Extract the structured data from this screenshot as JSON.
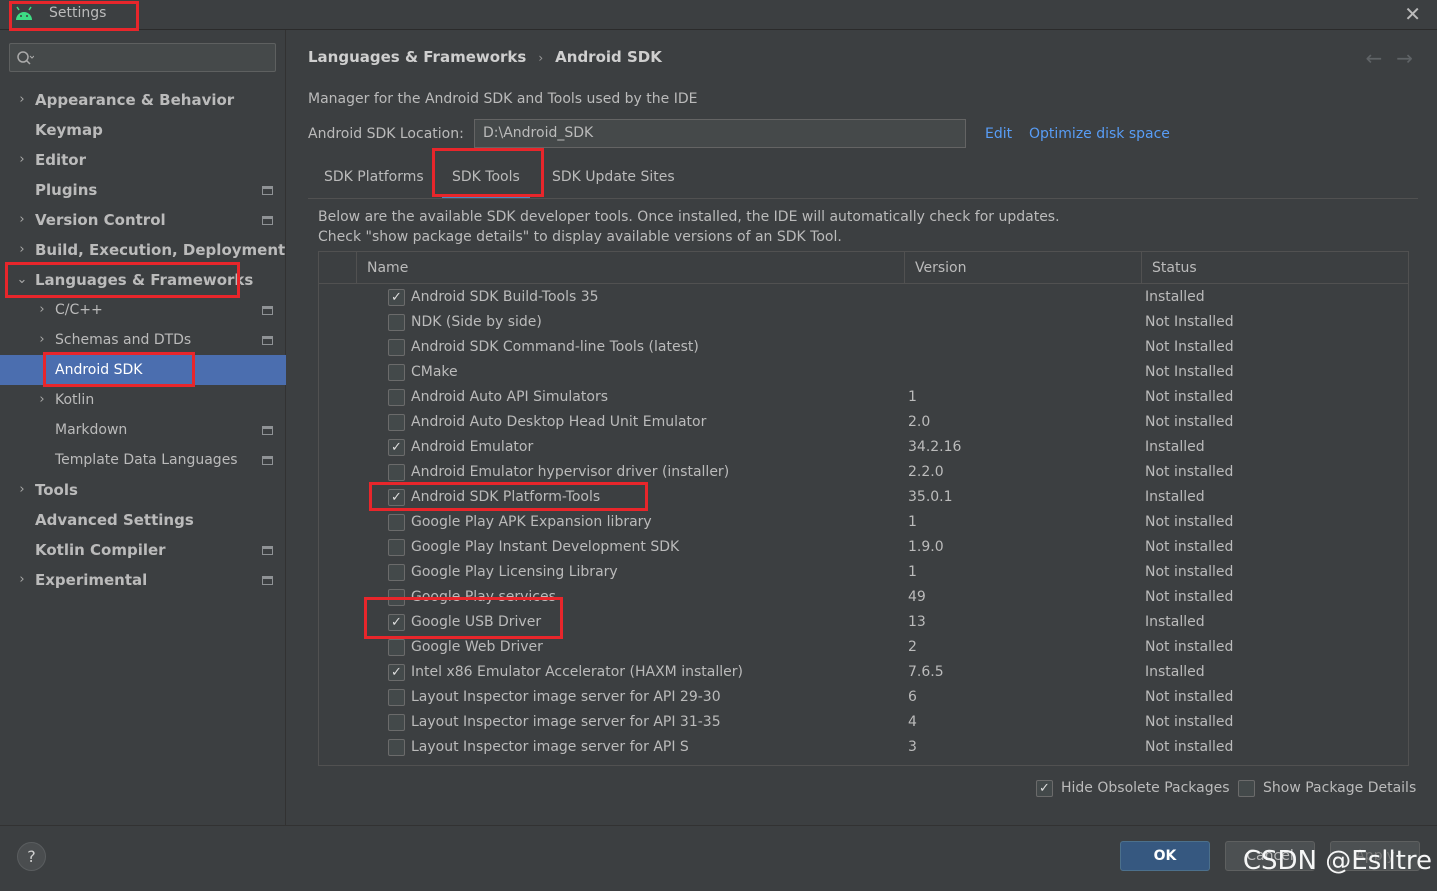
{
  "window": {
    "title": "Settings",
    "close": "✕"
  },
  "sidebar": {
    "items": [
      {
        "label": "Appearance & Behavior",
        "chevron": "›"
      },
      {
        "label": "Keymap"
      },
      {
        "label": "Editor",
        "chevron": "›"
      },
      {
        "label": "Plugins"
      },
      {
        "label": "Version Control",
        "chevron": "›"
      },
      {
        "label": "Build, Execution, Deployment",
        "chevron": "›"
      },
      {
        "label": "Languages & Frameworks",
        "chevron": "⌄"
      },
      {
        "label": "C/C++",
        "chevron": "›"
      },
      {
        "label": "Schemas and DTDs",
        "chevron": "›"
      },
      {
        "label": "Android SDK"
      },
      {
        "label": "Kotlin",
        "chevron": "›"
      },
      {
        "label": "Markdown"
      },
      {
        "label": "Template Data Languages"
      },
      {
        "label": "Tools",
        "chevron": "›"
      },
      {
        "label": "Advanced Settings"
      },
      {
        "label": "Kotlin Compiler"
      },
      {
        "label": "Experimental",
        "chevron": "›"
      }
    ]
  },
  "breadcrumb": {
    "parent": "Languages & Frameworks",
    "separator": "›",
    "current": "Android SDK"
  },
  "nav_arrows": "←→",
  "main": {
    "description": "Manager for the Android SDK and Tools used by the IDE",
    "location_label": "Android SDK Location:",
    "location_value": "D:\\Android_SDK",
    "edit_link": "Edit",
    "optimize_link": "Optimize disk space",
    "tabs": [
      "SDK Platforms",
      "SDK Tools",
      "SDK Update Sites"
    ],
    "active_tab": "SDK Tools",
    "tool_description": "Below are the available SDK developer tools. Once installed, the IDE will automatically check for updates. Check \"show package details\" to display available versions of an SDK Tool."
  },
  "table": {
    "headers": {
      "name": "Name",
      "version": "Version",
      "status": "Status"
    },
    "rows": [
      {
        "checked": true,
        "name": "Android SDK Build-Tools 35",
        "version": "",
        "status": "Installed"
      },
      {
        "checked": false,
        "name": "NDK (Side by side)",
        "version": "",
        "status": "Not Installed"
      },
      {
        "checked": false,
        "name": "Android SDK Command-line Tools (latest)",
        "version": "",
        "status": "Not Installed"
      },
      {
        "checked": false,
        "name": "CMake",
        "version": "",
        "status": "Not Installed"
      },
      {
        "checked": false,
        "name": "Android Auto API Simulators",
        "version": "1",
        "status": "Not installed"
      },
      {
        "checked": false,
        "name": "Android Auto Desktop Head Unit Emulator",
        "version": "2.0",
        "status": "Not installed"
      },
      {
        "checked": true,
        "name": "Android Emulator",
        "version": "34.2.16",
        "status": "Installed"
      },
      {
        "checked": false,
        "name": "Android Emulator hypervisor driver (installer)",
        "version": "2.2.0",
        "status": "Not installed"
      },
      {
        "checked": true,
        "name": "Android SDK Platform-Tools",
        "version": "35.0.1",
        "status": "Installed"
      },
      {
        "checked": false,
        "name": "Google Play APK Expansion library",
        "version": "1",
        "status": "Not installed"
      },
      {
        "checked": false,
        "name": "Google Play Instant Development SDK",
        "version": "1.9.0",
        "status": "Not installed"
      },
      {
        "checked": false,
        "name": "Google Play Licensing Library",
        "version": "1",
        "status": "Not installed"
      },
      {
        "checked": false,
        "name": "Google Play services",
        "version": "49",
        "status": "Not installed"
      },
      {
        "checked": true,
        "name": "Google USB Driver",
        "version": "13",
        "status": "Installed"
      },
      {
        "checked": false,
        "name": "Google Web Driver",
        "version": "2",
        "status": "Not installed"
      },
      {
        "checked": true,
        "name": "Intel x86 Emulator Accelerator (HAXM installer)",
        "version": "7.6.5",
        "status": "Installed"
      },
      {
        "checked": false,
        "name": "Layout Inspector image server for API 29-30",
        "version": "6",
        "status": "Not installed"
      },
      {
        "checked": false,
        "name": "Layout Inspector image server for API 31-35",
        "version": "4",
        "status": "Not installed"
      },
      {
        "checked": false,
        "name": "Layout Inspector image server for API S",
        "version": "3",
        "status": "Not installed"
      }
    ]
  },
  "options": {
    "hide_obsolete": {
      "label": "Hide Obsolete Packages",
      "checked": true
    },
    "show_details": {
      "label": "Show Package Details",
      "checked": false
    }
  },
  "buttons": {
    "help": "?",
    "ok": "OK",
    "cancel": "Cancel",
    "apply": "Apply"
  },
  "watermark": "CSDN @Eslltre",
  "colors": {
    "background": "#3c3f41",
    "selection": "#4b6eaf",
    "link": "#589df6",
    "highlight_box": "#e8262b",
    "android_green": "#3ddc84"
  }
}
